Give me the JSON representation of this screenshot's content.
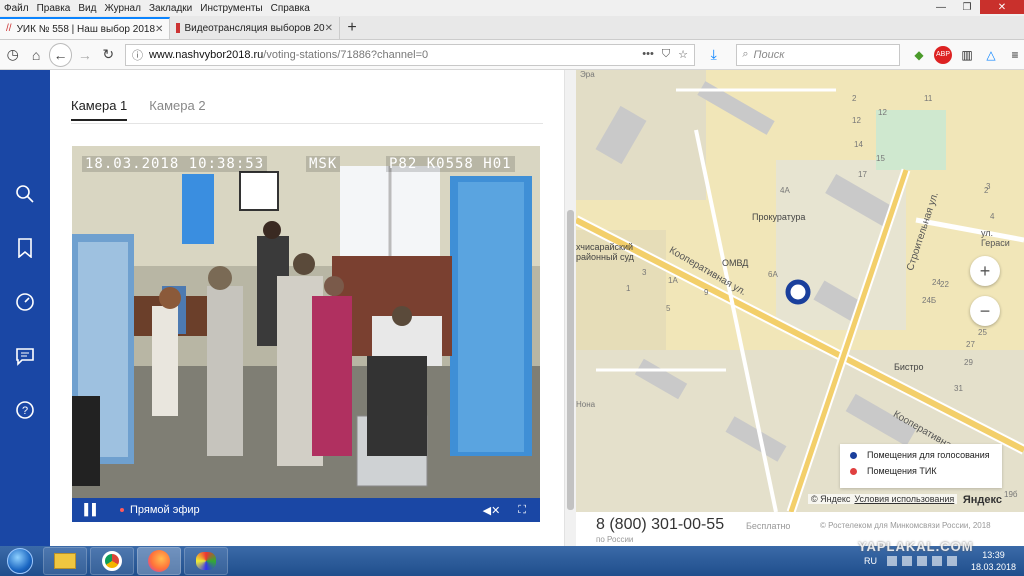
{
  "menu": [
    "Файл",
    "Правка",
    "Вид",
    "Журнал",
    "Закладки",
    "Инструменты",
    "Справка"
  ],
  "tabs": [
    {
      "label": "УИК № 558 | Наш выбор 2018",
      "active": true
    },
    {
      "label": "Видеотрансляция выборов 20",
      "active": false
    }
  ],
  "url": {
    "host": "www.nashvybor2018.ru",
    "path": "/voting-stations/71886?channel=0"
  },
  "search": {
    "placeholder": "Поиск"
  },
  "camera_tabs": [
    {
      "label": "Камера 1",
      "active": true
    },
    {
      "label": "Камера 2",
      "active": false
    }
  ],
  "video": {
    "timestamp": "18.03.2018 10:38:53",
    "timezone": "MSK",
    "station_code": "P82 K0558 H01",
    "live_label": "Прямой эфир"
  },
  "map": {
    "legend": [
      {
        "label": "Помещения для голосования",
        "color": "#1a3f9c"
      },
      {
        "label": "Помещения ТИК",
        "color": "#e04040"
      }
    ],
    "copyright": "© Яндекс",
    "terms_link": "Условия использования",
    "logo": "Яндекс",
    "zoom_in": "+",
    "zoom_out": "−",
    "streets": [
      "Кооперативная ул.",
      "Кооперативная ул.",
      "Строительная ул.",
      "ул. Гераси"
    ],
    "labels": [
      "Прокуратура",
      "ОМВД",
      "Бистро",
      "хчисарайский районный суд",
      "Эра",
      "Нона"
    ],
    "numbers": [
      "2",
      "12",
      "11",
      "12",
      "14",
      "15",
      "17",
      "4А",
      "6А",
      "3",
      "1А",
      "9",
      "1",
      "5",
      "22",
      "24Б",
      "24",
      "25",
      "27",
      "29",
      "31",
      "3",
      "2",
      "4",
      "6",
      "19б"
    ]
  },
  "footer": {
    "phone": "8 (800) 301-00-55",
    "phone_sub": "по России",
    "free": "Бесплатно",
    "copyright": "© Ростелеком для Минкомсвязи России, 2018"
  },
  "taskbar": {
    "lang": "RU",
    "time": "13:39",
    "date": "18.03.2018"
  },
  "watermark": "YAPLAKAL.COM"
}
